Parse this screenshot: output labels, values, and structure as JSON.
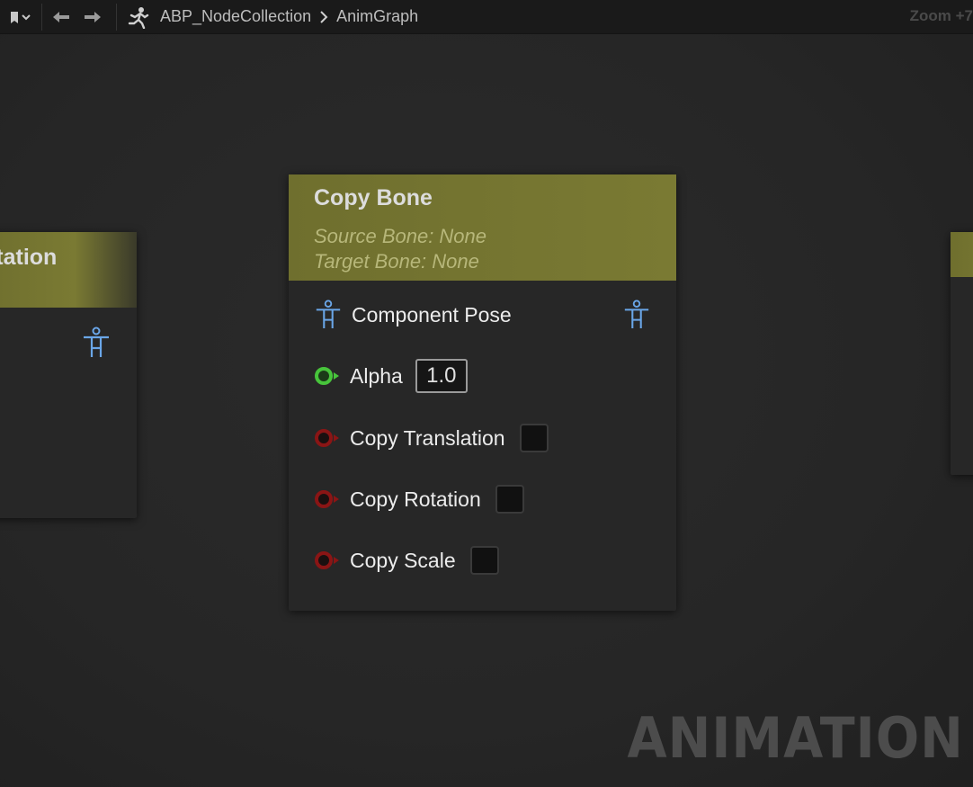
{
  "toolbar": {
    "breadcrumb_asset": "ABP_NodeCollection",
    "breadcrumb_graph": "AnimGraph",
    "zoom": "Zoom +7"
  },
  "node_main": {
    "title": "Copy Bone",
    "source_bone": "Source Bone: None",
    "target_bone": "Target Bone: None",
    "pose_label": "Component Pose",
    "alpha_label": "Alpha",
    "alpha_value": "1.0",
    "copy_translation_label": "Copy Translation",
    "copy_rotation_label": "Copy Rotation",
    "copy_scale_label": "Copy Scale"
  },
  "node_left": {
    "title": "otation"
  },
  "colors": {
    "header": "#7a7a33",
    "pose_pin": "#6aa6e8",
    "float_pin": "#47c43b",
    "bool_pin": "#8a1515"
  },
  "watermark": "ANIMATION"
}
